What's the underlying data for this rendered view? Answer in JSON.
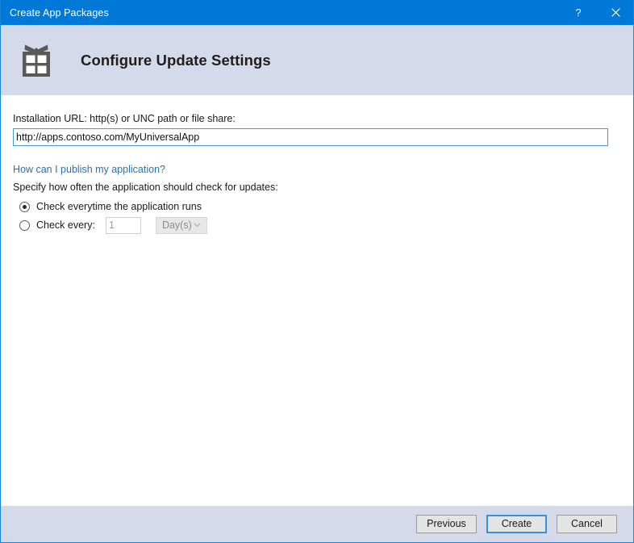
{
  "window": {
    "title": "Create App Packages",
    "help_button": "?",
    "close_button": "✕",
    "accent_color": "#0078d7",
    "header_band_color": "#d4dae9"
  },
  "header": {
    "icon": "gift-package-icon",
    "title": "Configure Update Settings"
  },
  "form": {
    "url_label": "Installation URL: http(s) or UNC path or file share:",
    "url_value": "http://apps.contoso.com/MyUniversalApp",
    "url_placeholder": "",
    "help_link": "How can I publish my application?",
    "help_link_color": "#1f72c0",
    "frequency_label": "Specify how often the application should check for updates:",
    "options": [
      {
        "label": "Check everytime the application runs",
        "checked": true
      },
      {
        "label": "Check every:",
        "checked": false
      }
    ],
    "interval_value": "1",
    "interval_enabled": false,
    "unit_value": "Day(s)",
    "unit_enabled": false,
    "unit_chevron": "chevron-down-icon"
  },
  "footer": {
    "previous_label": "Previous",
    "create_label": "Create",
    "cancel_label": "Cancel",
    "default_button": "Create"
  }
}
